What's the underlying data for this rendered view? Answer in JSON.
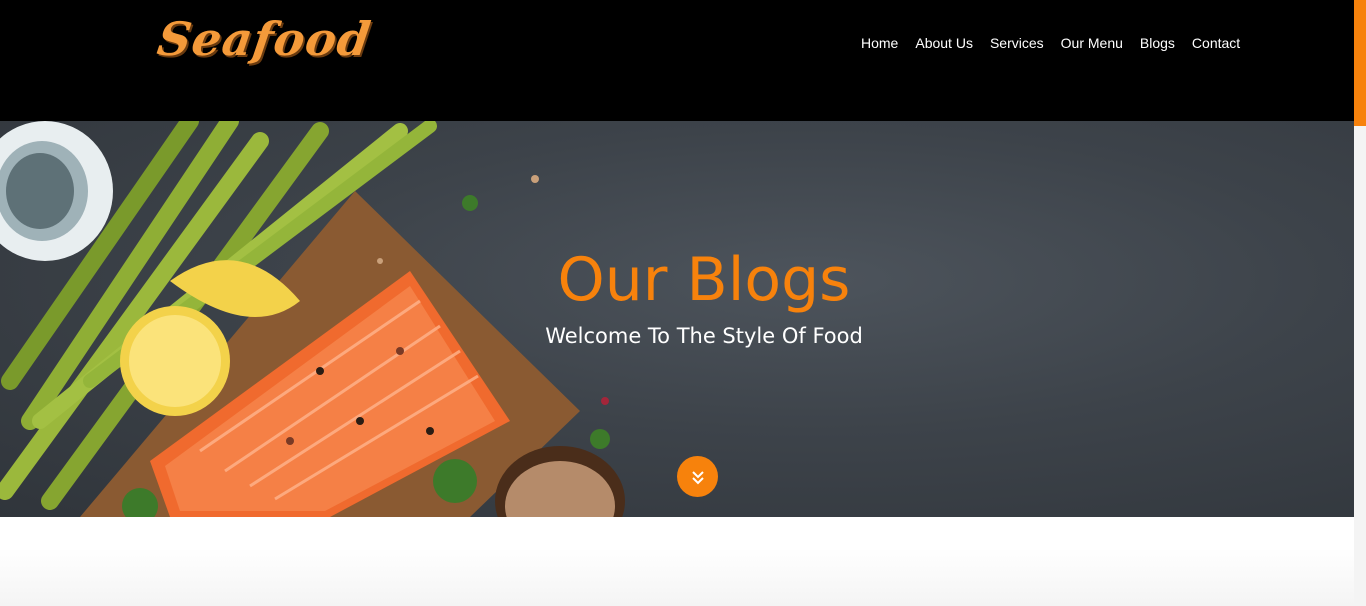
{
  "brand": {
    "logo": "Seafood"
  },
  "nav": {
    "items": [
      {
        "label": "Home"
      },
      {
        "label": "About Us"
      },
      {
        "label": "Services"
      },
      {
        "label": "Our Menu"
      },
      {
        "label": "Blogs"
      },
      {
        "label": "Contact"
      }
    ]
  },
  "hero": {
    "title": "Our Blogs",
    "subtitle": "Welcome To The Style Of Food",
    "scroll_icon": "chevron-double-down-icon"
  },
  "colors": {
    "accent": "#f7820c",
    "header_bg": "#000000",
    "logo": "#f49a3a"
  }
}
